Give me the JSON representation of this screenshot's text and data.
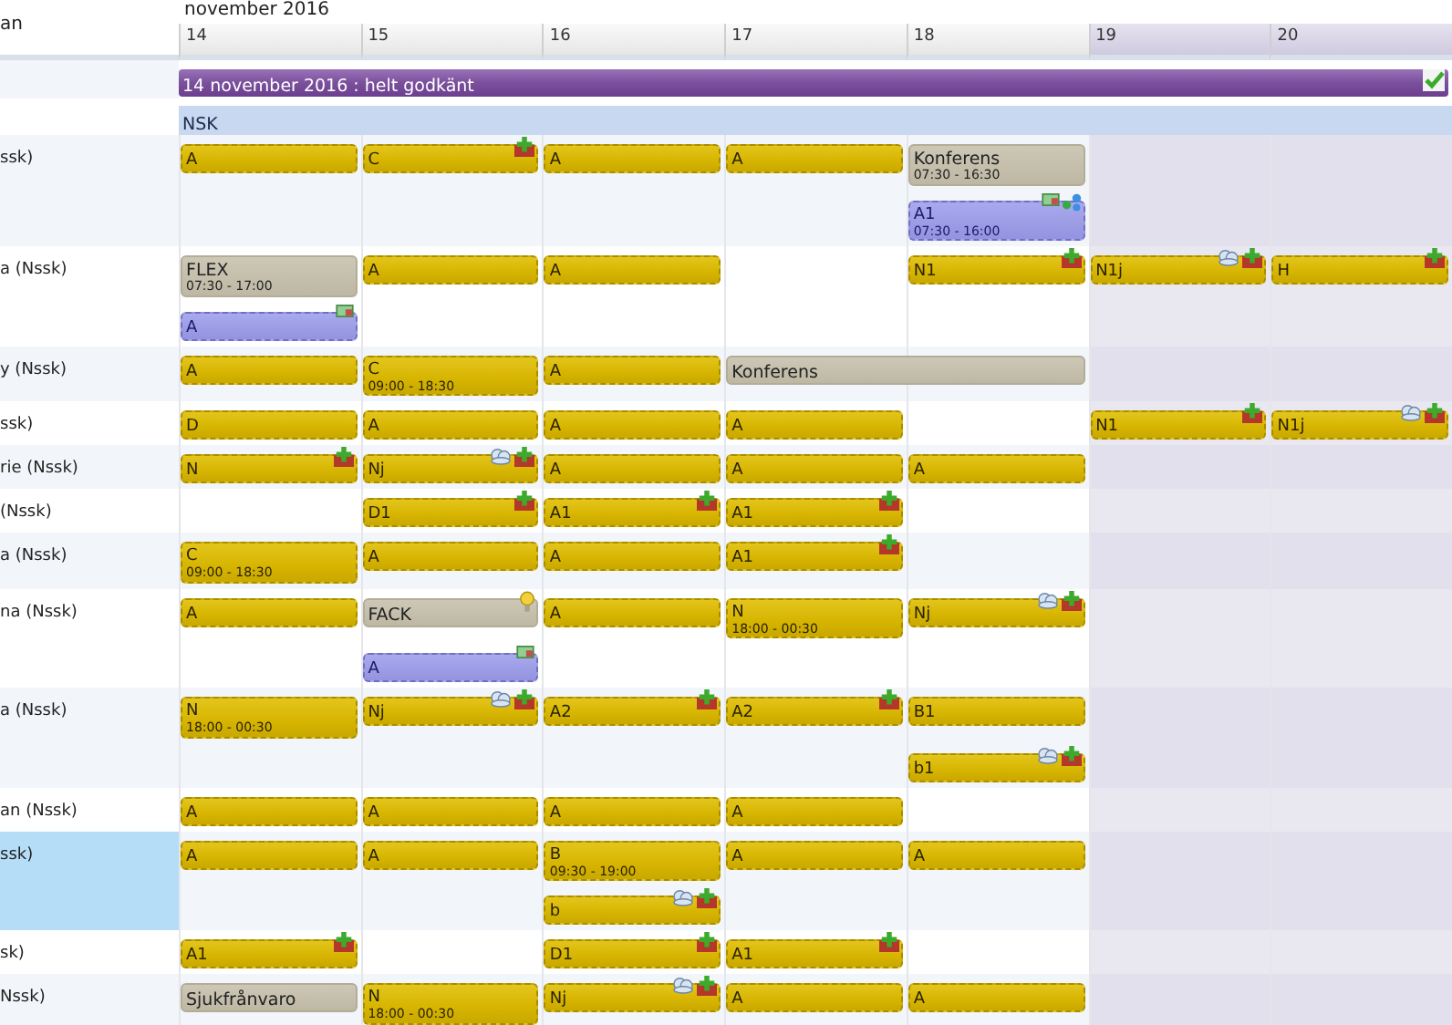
{
  "header": {
    "month": "november 2016",
    "name_column": "an"
  },
  "days": [
    {
      "label": "14",
      "weekend": false
    },
    {
      "label": "15",
      "weekend": false
    },
    {
      "label": "16",
      "weekend": false
    },
    {
      "label": "17",
      "weekend": false
    },
    {
      "label": "18",
      "weekend": false
    },
    {
      "label": "19",
      "weekend": true
    },
    {
      "label": "20",
      "weekend": true
    }
  ],
  "approval": {
    "text": "14 november 2016 : helt godkänt",
    "approved": true
  },
  "unit": {
    "text": "NSK"
  },
  "rows": [
    {
      "name": "ssk)",
      "selected": false,
      "cells": [
        [
          {
            "kind": "shift",
            "code": "A"
          }
        ],
        [
          {
            "kind": "shift",
            "code": "C",
            "icons": [
              {
                "kind": "plus"
              }
            ]
          }
        ],
        [
          {
            "kind": "shift",
            "code": "A"
          }
        ],
        [
          {
            "kind": "shift",
            "code": "A"
          }
        ],
        [
          {
            "kind": "absence",
            "code": "Konferens",
            "time": "07:30 - 16:30"
          },
          {
            "kind": "extra",
            "code": "A1",
            "time": "07:30 - 16:00",
            "icons": [
              {
                "kind": "note"
              },
              {
                "kind": "swap"
              }
            ]
          }
        ],
        [],
        []
      ]
    },
    {
      "name": "a (Nssk)",
      "selected": false,
      "cells": [
        [
          {
            "kind": "absence",
            "code": "FLEX",
            "time": "07:30 - 17:00"
          },
          {
            "kind": "extra",
            "code": "A",
            "icons": [
              {
                "kind": "note"
              }
            ]
          }
        ],
        [
          {
            "kind": "shift",
            "code": "A"
          }
        ],
        [
          {
            "kind": "shift",
            "code": "A"
          }
        ],
        [],
        [
          {
            "kind": "shift",
            "code": "N1",
            "icons": [
              {
                "kind": "plus"
              }
            ]
          }
        ],
        [
          {
            "kind": "shift",
            "code": "N1j",
            "icons": [
              {
                "kind": "cloud"
              },
              {
                "kind": "plus"
              }
            ]
          }
        ],
        [
          {
            "kind": "shift",
            "code": "H",
            "icons": [
              {
                "kind": "plus"
              }
            ]
          }
        ]
      ]
    },
    {
      "name": "y (Nssk)",
      "selected": false,
      "cells": [
        [
          {
            "kind": "shift",
            "code": "A"
          }
        ],
        [
          {
            "kind": "shift",
            "code": "C",
            "time": "09:00 - 18:30"
          }
        ],
        [
          {
            "kind": "shift",
            "code": "A"
          }
        ],
        [
          {
            "kind": "absence",
            "code": "Konferens",
            "extends": true
          }
        ],
        [],
        [],
        []
      ]
    },
    {
      "name": "ssk)",
      "selected": false,
      "cells": [
        [
          {
            "kind": "shift",
            "code": "D"
          }
        ],
        [
          {
            "kind": "shift",
            "code": "A"
          }
        ],
        [
          {
            "kind": "shift",
            "code": "A"
          }
        ],
        [
          {
            "kind": "shift",
            "code": "A"
          }
        ],
        [],
        [
          {
            "kind": "shift",
            "code": "N1",
            "icons": [
              {
                "kind": "plus"
              }
            ]
          }
        ],
        [
          {
            "kind": "shift",
            "code": "N1j",
            "icons": [
              {
                "kind": "cloud"
              },
              {
                "kind": "plus"
              }
            ]
          }
        ]
      ]
    },
    {
      "name": "rie (Nssk)",
      "selected": false,
      "cells": [
        [
          {
            "kind": "shift",
            "code": "N",
            "icons": [
              {
                "kind": "plus"
              }
            ]
          }
        ],
        [
          {
            "kind": "shift",
            "code": "Nj",
            "icons": [
              {
                "kind": "cloud"
              },
              {
                "kind": "plus"
              }
            ]
          }
        ],
        [
          {
            "kind": "shift",
            "code": "A"
          }
        ],
        [
          {
            "kind": "shift",
            "code": "A"
          }
        ],
        [
          {
            "kind": "shift",
            "code": "A"
          }
        ],
        [],
        []
      ]
    },
    {
      "name": "(Nssk)",
      "selected": false,
      "cells": [
        [],
        [
          {
            "kind": "shift",
            "code": "D1",
            "icons": [
              {
                "kind": "plus"
              }
            ]
          }
        ],
        [
          {
            "kind": "shift",
            "code": "A1",
            "icons": [
              {
                "kind": "plus"
              }
            ]
          }
        ],
        [
          {
            "kind": "shift",
            "code": "A1",
            "icons": [
              {
                "kind": "plus"
              }
            ]
          }
        ],
        [],
        [],
        []
      ]
    },
    {
      "name": "a (Nssk)",
      "selected": false,
      "cells": [
        [
          {
            "kind": "shift",
            "code": "C",
            "time": "09:00 - 18:30"
          }
        ],
        [
          {
            "kind": "shift",
            "code": "A"
          }
        ],
        [
          {
            "kind": "shift",
            "code": "A"
          }
        ],
        [
          {
            "kind": "shift",
            "code": "A1",
            "icons": [
              {
                "kind": "plus"
              }
            ]
          }
        ],
        [],
        [],
        []
      ]
    },
    {
      "name": "na (Nssk)",
      "selected": false,
      "cells": [
        [
          {
            "kind": "shift",
            "code": "A"
          }
        ],
        [
          {
            "kind": "absence",
            "code": "FACK",
            "icons": [
              {
                "kind": "bulb"
              }
            ]
          },
          {
            "kind": "extra",
            "code": "A",
            "icons": [
              {
                "kind": "note"
              }
            ]
          }
        ],
        [
          {
            "kind": "shift",
            "code": "A"
          }
        ],
        [
          {
            "kind": "shift",
            "code": "N",
            "time": "18:00 - 00:30"
          }
        ],
        [
          {
            "kind": "shift",
            "code": "Nj",
            "icons": [
              {
                "kind": "cloud"
              },
              {
                "kind": "plus"
              }
            ]
          }
        ],
        [],
        []
      ]
    },
    {
      "name": "a (Nssk)",
      "selected": false,
      "cells": [
        [
          {
            "kind": "shift",
            "code": "N",
            "time": "18:00 - 00:30"
          }
        ],
        [
          {
            "kind": "shift",
            "code": "Nj",
            "icons": [
              {
                "kind": "cloud"
              },
              {
                "kind": "plus"
              }
            ]
          }
        ],
        [
          {
            "kind": "shift",
            "code": "A2",
            "icons": [
              {
                "kind": "plus"
              }
            ]
          }
        ],
        [
          {
            "kind": "shift",
            "code": "A2",
            "icons": [
              {
                "kind": "plus"
              }
            ]
          }
        ],
        [
          {
            "kind": "shift",
            "code": "B1"
          },
          {
            "kind": "shift",
            "code": "b1",
            "icons": [
              {
                "kind": "cloud"
              },
              {
                "kind": "plus"
              }
            ]
          }
        ],
        [],
        []
      ]
    },
    {
      "name": "an (Nssk)",
      "selected": false,
      "cells": [
        [
          {
            "kind": "shift",
            "code": "A"
          }
        ],
        [
          {
            "kind": "shift",
            "code": "A"
          }
        ],
        [
          {
            "kind": "shift",
            "code": "A"
          }
        ],
        [
          {
            "kind": "shift",
            "code": "A"
          }
        ],
        [],
        [],
        []
      ]
    },
    {
      "name": "ssk)",
      "selected": true,
      "cells": [
        [
          {
            "kind": "shift",
            "code": "A"
          }
        ],
        [
          {
            "kind": "shift",
            "code": "A"
          }
        ],
        [
          {
            "kind": "shift",
            "code": "B",
            "time": "09:30 - 19:00"
          },
          {
            "kind": "shift",
            "code": "b",
            "icons": [
              {
                "kind": "cloud"
              },
              {
                "kind": "plus"
              }
            ]
          }
        ],
        [
          {
            "kind": "shift",
            "code": "A"
          }
        ],
        [
          {
            "kind": "shift",
            "code": "A"
          }
        ],
        [],
        []
      ]
    },
    {
      "name": "sk)",
      "selected": false,
      "cells": [
        [
          {
            "kind": "shift",
            "code": "A1",
            "icons": [
              {
                "kind": "plus"
              }
            ]
          }
        ],
        [],
        [
          {
            "kind": "shift",
            "code": "D1",
            "icons": [
              {
                "kind": "plus"
              }
            ]
          }
        ],
        [
          {
            "kind": "shift",
            "code": "A1",
            "icons": [
              {
                "kind": "plus"
              }
            ]
          }
        ],
        [],
        [],
        []
      ]
    },
    {
      "name": "Nssk)",
      "selected": false,
      "cells": [
        [
          {
            "kind": "absence",
            "code": "Sjukfrånvaro"
          }
        ],
        [
          {
            "kind": "shift",
            "code": "N",
            "time": "18:00 - 00:30"
          }
        ],
        [
          {
            "kind": "shift",
            "code": "Nj",
            "icons": [
              {
                "kind": "cloud"
              },
              {
                "kind": "plus"
              }
            ]
          }
        ],
        [
          {
            "kind": "shift",
            "code": "A"
          }
        ],
        [
          {
            "kind": "shift",
            "code": "A"
          }
        ],
        [],
        []
      ]
    }
  ]
}
